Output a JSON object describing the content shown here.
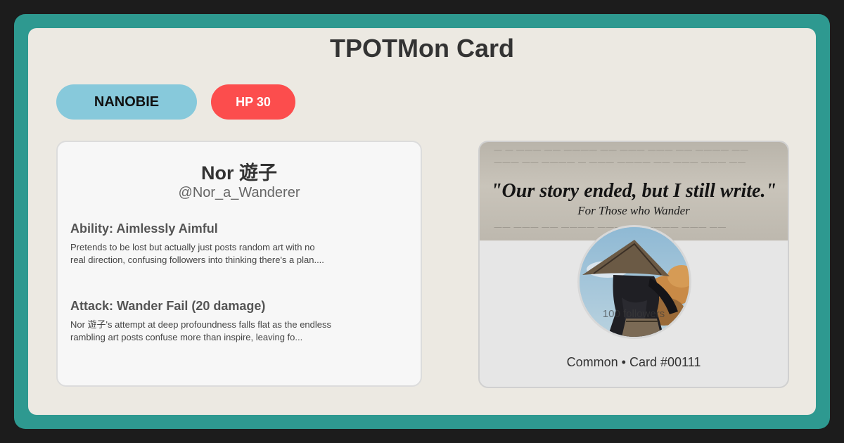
{
  "title": "TPOTMon Card",
  "type_pill": "NANOBIE",
  "hp_pill": "HP 30",
  "profile": {
    "name": "Nor 遊子",
    "handle": "@Nor_a_Wanderer"
  },
  "ability": {
    "title": "Ability: Aimlessly Aimful",
    "text": "Pretends to be lost but actually just posts random art with no real direction, confusing followers into thinking there's a plan...."
  },
  "attack": {
    "title": "Attack: Wander Fail (20 damage)",
    "text": "Nor 遊子's attempt at deep profoundness falls flat as the endless rambling art posts confuse more than inspire, leaving fo..."
  },
  "banner": {
    "quote": "\"Our story ended, but I still write.\"",
    "subtitle": "For Those who Wander"
  },
  "followers": "100 followers",
  "rarity_line": "Common • Card #00111",
  "colors": {
    "frame": "#2e9990",
    "card": "#ece9e2",
    "type_pill": "#87c9db",
    "hp_pill": "#fc4d4d"
  }
}
